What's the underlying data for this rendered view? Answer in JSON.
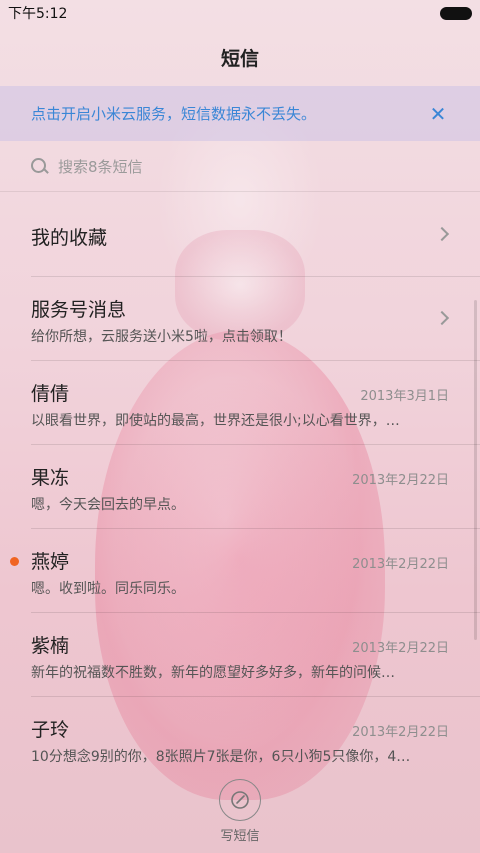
{
  "statusbar": {
    "time": "下午5:12"
  },
  "header": {
    "title": "短信"
  },
  "banner": {
    "text": "点击开启小米云服务，短信数据永不丢失。",
    "close_icon": "close-icon"
  },
  "search": {
    "placeholder": "搜索8条短信"
  },
  "list": {
    "favorites": {
      "label": "我的收藏"
    },
    "service": {
      "name": "服务号消息",
      "snippet": "给你所想，云服务送小米5啦，点击领取！"
    },
    "conversations": [
      {
        "name": "倩倩",
        "date": "2013年3月1日",
        "snippet": "以眼看世界，即使站的最高，世界还是很小;以心看世界，…",
        "unread": false
      },
      {
        "name": "果冻",
        "date": "2013年2月22日",
        "snippet": "嗯，今天会回去的早点。",
        "unread": false
      },
      {
        "name": "燕婷",
        "date": "2013年2月22日",
        "snippet": "嗯。收到啦。同乐同乐。",
        "unread": true
      },
      {
        "name": "紫楠",
        "date": "2013年2月22日",
        "snippet": "新年的祝福数不胜数，新年的愿望好多好多，新年的问候…",
        "unread": false
      },
      {
        "name": "子玲",
        "date": "2013年2月22日",
        "snippet": "10分想念9别的你，8张照片7张是你，6只小狗5只像你，4…",
        "unread": false
      }
    ]
  },
  "compose": {
    "label": "写短信"
  },
  "colors": {
    "accent": "#3a86d6",
    "unread": "#f06422"
  }
}
